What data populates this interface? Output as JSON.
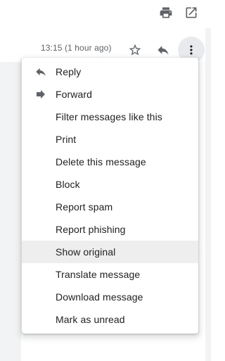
{
  "toolbar": {
    "print_icon": "printer-icon",
    "open_new_window_icon": "open-in-new-window-icon"
  },
  "message_header": {
    "timestamp": "13:15 (1 hour ago)",
    "star_icon": "star-outline-icon",
    "reply_icon": "reply-icon",
    "more_icon": "more-vertical-icon"
  },
  "menu": {
    "items": [
      {
        "label": "Reply",
        "icon": "reply-icon"
      },
      {
        "label": "Forward",
        "icon": "forward-icon"
      },
      {
        "label": "Filter messages like this"
      },
      {
        "label": "Print"
      },
      {
        "label": "Delete this message"
      },
      {
        "label": "Block"
      },
      {
        "label": "Report spam"
      },
      {
        "label": "Report phishing"
      },
      {
        "label": "Show original",
        "highlighted": true
      },
      {
        "label": "Translate message"
      },
      {
        "label": "Download message"
      },
      {
        "label": "Mark as unread"
      }
    ]
  },
  "colors": {
    "icon": "#5f6368",
    "text": "#202124",
    "highlight": "#eeeeee",
    "gray_panel": "#f1f3f4"
  }
}
